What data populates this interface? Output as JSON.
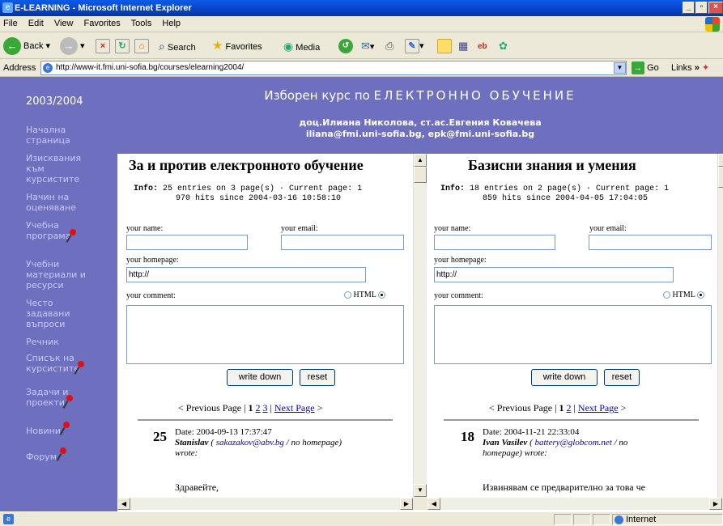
{
  "window": {
    "title": "E-LEARNING - Microsoft Internet Explorer"
  },
  "menu": [
    "File",
    "Edit",
    "View",
    "Favorites",
    "Tools",
    "Help"
  ],
  "toolbar": {
    "back": "Back",
    "search": "Search",
    "favorites": "Favorites",
    "media": "Media"
  },
  "address": {
    "label": "Address",
    "url": "http://www-it.fmi.uni-sofia.bg/courses/elearning2004/",
    "go": "Go",
    "links": "Links"
  },
  "sidebar": {
    "year": "2003/2004",
    "items": [
      {
        "label": "Начална страница"
      },
      {
        "label": "Изисквания към курсистите"
      },
      {
        "label": "Начин на оценяване"
      },
      {
        "label": "Учебна програма"
      },
      {
        "label": "Учебни материали и ресурси"
      },
      {
        "label": "Често задавани въпроси"
      },
      {
        "label": "Речник"
      },
      {
        "label": "Списък на курсистите"
      },
      {
        "label": "Задачи и проекти"
      },
      {
        "label": "Новини"
      },
      {
        "label": "Форум"
      }
    ]
  },
  "header": {
    "title_prefix": "Изборен курс по",
    "title_main": "ЕЛЕКТРОННО ОБУЧЕНИЕ",
    "authors": "доц.Илиана Николова, ст.ас.Евгения Ковачева",
    "emails": "iliana@fmi.uni-sofia.bg, epk@fmi.uni-sofia.bg"
  },
  "guestbooks": [
    {
      "title": "За и против електронното обучение",
      "info_label": "Info:",
      "info_line1": "25 entries on 3 page(s) · Current page: 1",
      "info_line2": "970 hits since 2004-03-16 10:58:10",
      "name_label": "your name:",
      "email_label": "your email:",
      "homepage_label": "your homepage:",
      "homepage_value": "http://",
      "comment_label": "your comment:",
      "html_label": "HTML",
      "write_button": "write down",
      "reset_button": "reset",
      "prev": "< Previous Page",
      "sep": "|",
      "current_page": "1",
      "pages": [
        "2",
        "3"
      ],
      "next": "Next Page",
      "next_arrow": ">",
      "entry": {
        "number": "25",
        "date": "Date: 2004-09-13 17:37:47",
        "author": "Stanislav",
        "email": "sakazakov@abv.bg",
        "rest": "/ no homepage) wrote:",
        "body": "Здравейте,"
      }
    },
    {
      "title": "Базисни знания и умения",
      "info_label": "Info:",
      "info_line1": "18 entries on 2 page(s) · Current page: 1",
      "info_line2": "859 hits since 2004-04-05 17:04:05",
      "name_label": "your name:",
      "email_label": "your email:",
      "homepage_label": "your homepage:",
      "homepage_value": "http://",
      "comment_label": "your comment:",
      "html_label": "HTML",
      "write_button": "write down",
      "reset_button": "reset",
      "prev": "< Previous Page",
      "sep": "|",
      "current_page": "1",
      "pages": [
        "2"
      ],
      "next": "Next Page",
      "next_arrow": ">",
      "entry": {
        "number": "18",
        "date": "Date: 2004-11-21 22:33:04",
        "author": "Ivan Vasilev",
        "email": "battery@globcom.net",
        "rest": "/ no homepage) wrote:",
        "body": "Извинявам се предварително за това че"
      }
    }
  ],
  "status": {
    "zone": "Internet"
  }
}
